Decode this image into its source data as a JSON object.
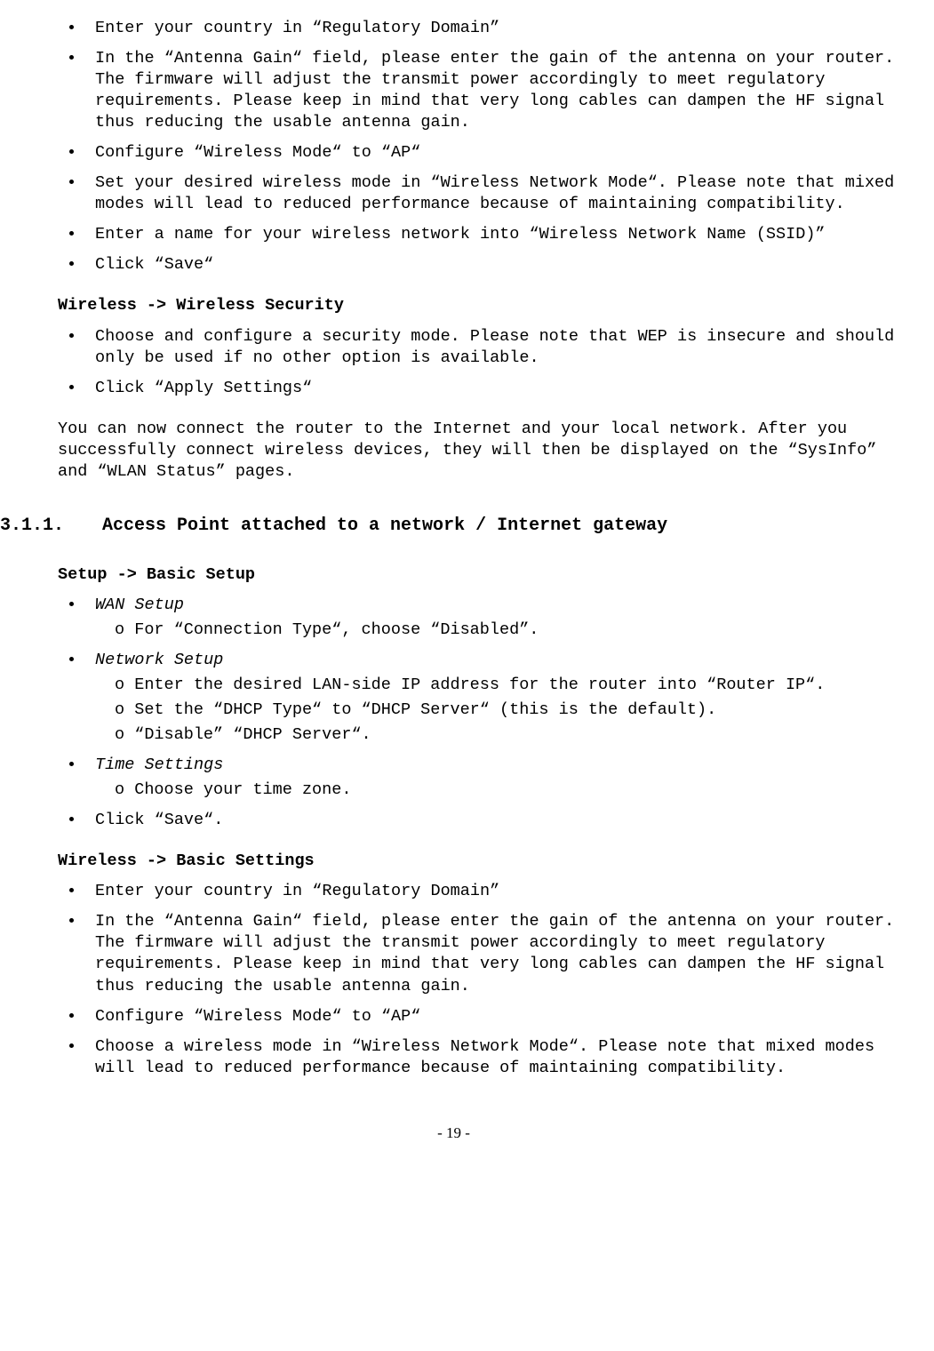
{
  "section1": {
    "bullets": [
      "Enter your country in “Regulatory Domain”",
      "In the “Antenna Gain“ field, please enter the gain of the antenna on your router. The firmware will adjust the transmit power accordingly to meet regulatory requirements. Please keep in mind that very long cables can dampen the HF signal thus reducing the usable antenna gain.",
      "Configure “Wireless Mode“ to “AP“",
      "Set your desired wireless mode in “Wireless Network Mode“. Please note that mixed modes will lead to reduced performance because of maintaining compatibility.",
      "Enter a name for your wireless network into “Wireless Network Name (SSID)”",
      "Click “Save“"
    ]
  },
  "section2": {
    "heading": "Wireless -> Wireless Security",
    "bullets": [
      "Choose and configure a security mode.  Please note that WEP is insecure and should only be used if no other option is available.",
      "Click “Apply Settings“"
    ],
    "paragraph": "You can now connect the router to the Internet and your local network. After you successfully connect wireless devices, they will then be displayed on the “SysInfo” and “WLAN Status” pages."
  },
  "numbered": {
    "num": "3.1.1.",
    "title": "Access Point attached to a network / Internet gateway"
  },
  "section3": {
    "heading": "Setup -> Basic Setup",
    "items": [
      {
        "label": "WAN Setup",
        "italic": true,
        "sub": [
          "For “Connection Type“, choose “Disabled”."
        ]
      },
      {
        "label": "Network Setup",
        "italic": true,
        "sub": [
          "Enter the desired LAN-side IP address for the router into “Router IP“.",
          "Set the “DHCP Type“ to “DHCP Server“ (this is the default).",
          "“Disable” “DHCP Server“."
        ]
      },
      {
        "label": "Time Settings",
        "italic": true,
        "sub": [
          "Choose your time zone."
        ]
      },
      {
        "label": "Click “Save“.",
        "italic": false,
        "sub": []
      }
    ]
  },
  "section4": {
    "heading": "Wireless -> Basic Settings",
    "bullets": [
      "Enter your country in “Regulatory Domain”",
      "In the “Antenna Gain“ field, please enter the gain of the antenna on your router. The firmware will adjust the transmit power accordingly to meet regulatory requirements. Please keep in mind that very long cables can dampen the HF signal thus reducing the usable antenna gain.",
      "Configure “Wireless Mode“ to “AP“",
      "Choose a wireless mode in “Wireless Network Mode“. Please note that mixed modes will lead to reduced performance because of maintaining compatibility."
    ]
  },
  "pageNumber": "- 19 -"
}
